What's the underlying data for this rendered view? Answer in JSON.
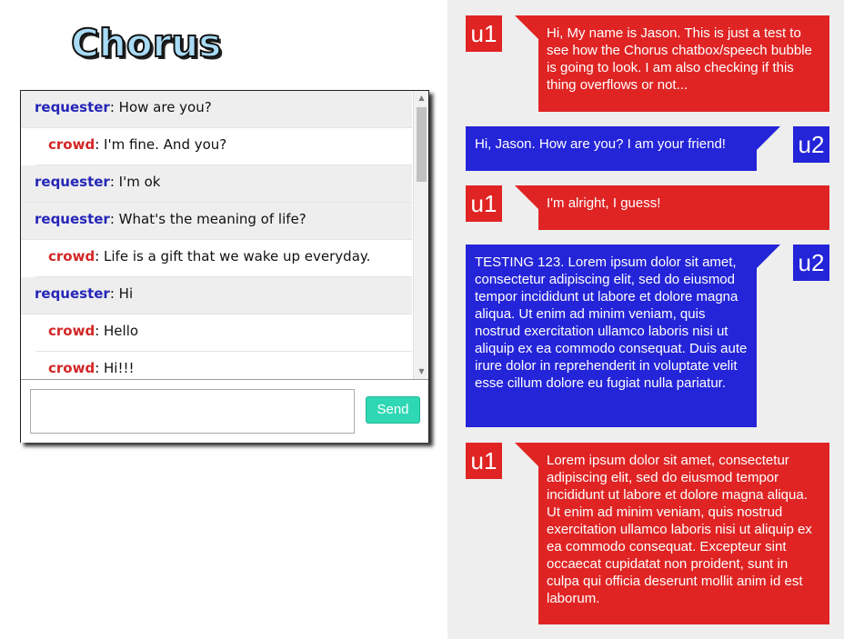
{
  "app": {
    "logo_text": "Chorus"
  },
  "chat": {
    "messages": [
      {
        "role": "requester",
        "text": ": How are you?"
      },
      {
        "role": "crowd",
        "text": ": I'm fine. And you?"
      },
      {
        "role": "requester",
        "text": ": I'm ok"
      },
      {
        "role": "requester",
        "text": ": What's the meaning of life?"
      },
      {
        "role": "crowd",
        "text": ": Life is a gift that we wake up everyday."
      },
      {
        "role": "requester",
        "text": ": Hi"
      },
      {
        "role": "crowd",
        "text": ": Hello"
      },
      {
        "role": "crowd",
        "text": ": Hi!!!"
      }
    ],
    "input": {
      "value": "",
      "placeholder": ""
    },
    "send_label": "Send"
  },
  "bubbles": [
    {
      "user": "u1",
      "side": "left",
      "color": "#e02424",
      "text": "Hi, My name is Jason. This is just a test to see how the Chorus chatbox/speech bubble is going to look. I am also checking if this thing overflows or not..."
    },
    {
      "user": "u2",
      "side": "right",
      "color": "#2424d8",
      "text": "Hi, Jason. How are you? I am your friend!"
    },
    {
      "user": "u1",
      "side": "left",
      "color": "#e02424",
      "text": "I'm alright, I guess!"
    },
    {
      "user": "u2",
      "side": "right",
      "color": "#2424d8",
      "text": "TESTING 123. Lorem ipsum dolor sit amet, consectetur adipiscing elit, sed do eiusmod tempor incididunt ut labore et dolore magna aliqua. Ut enim ad minim veniam, quis nostrud exercitation ullamco laboris nisi ut aliquip ex ea commodo consequat. Duis aute irure dolor in reprehenderit in voluptate velit esse cillum dolore eu fugiat nulla pariatur."
    },
    {
      "user": "u1",
      "side": "left",
      "color": "#e02424",
      "text": "Lorem ipsum dolor sit amet, consectetur adipiscing elit, sed do eiusmod tempor incididunt ut labore et dolore magna aliqua. Ut enim ad minim veniam, quis nostrud exercitation ullamco laboris nisi ut aliquip ex ea commodo consequat. Excepteur sint occaecat cupidatat non proident, sunt in culpa qui officia deserunt mollit anim id est laborum."
    }
  ],
  "icons": {
    "scroll_up": "triangle-up-icon",
    "scroll_down": "triangle-down-icon"
  }
}
